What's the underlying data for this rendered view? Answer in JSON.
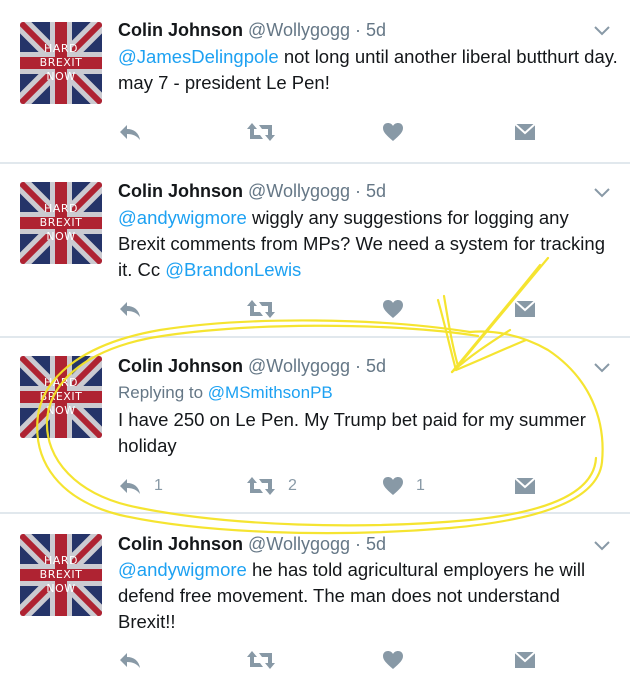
{
  "tweets": [
    {
      "name": "Colin Johnson",
      "handle": "@Wollygogg",
      "time": "5d",
      "avatar_lines": [
        "HARD",
        "BREXIT",
        "NOW"
      ],
      "mention": "@JamesDelingpole",
      "text": " not long until another liberal butthurt day. may 7 - president Le Pen!",
      "reply_count": "",
      "retweet_count": "",
      "like_count": ""
    },
    {
      "name": "Colin Johnson",
      "handle": "@Wollygogg",
      "time": "5d",
      "avatar_lines": [
        "HARD",
        "BREXIT",
        "NOW"
      ],
      "mention": "@andywigmore",
      "text": " wiggly any suggestions for logging any Brexit comments from MPs? We need a system for tracking it. Cc ",
      "mention2": "@BrandonLewis",
      "reply_count": "",
      "retweet_count": "",
      "like_count": ""
    },
    {
      "name": "Colin Johnson",
      "handle": "@Wollygogg",
      "time": "5d",
      "avatar_lines": [
        "HARD",
        "BREXIT",
        "NOW"
      ],
      "replying_label": "Replying to ",
      "replying_to": "@MSmithsonPB",
      "text": "I have 250 on Le Pen. My Trump bet paid for my summer holiday",
      "reply_count": "1",
      "retweet_count": "2",
      "like_count": "1"
    },
    {
      "name": "Colin Johnson",
      "handle": "@Wollygogg",
      "time": "5d",
      "avatar_lines": [
        "HARD",
        "BREXIT",
        "NOW"
      ],
      "mention": "@andywigmore",
      "text": " he has told agricultural employers he will defend free movement. The man does not understand Brexit!!",
      "reply_count": "",
      "retweet_count": "",
      "like_count": ""
    }
  ],
  "colors": {
    "mention": "#1da1f2",
    "secondary": "#657786",
    "icon": "#8899a6",
    "annotation": "#f5e326"
  },
  "icons": [
    "reply-icon",
    "retweet-icon",
    "like-icon",
    "direct-message-icon",
    "chevron-down-icon"
  ]
}
